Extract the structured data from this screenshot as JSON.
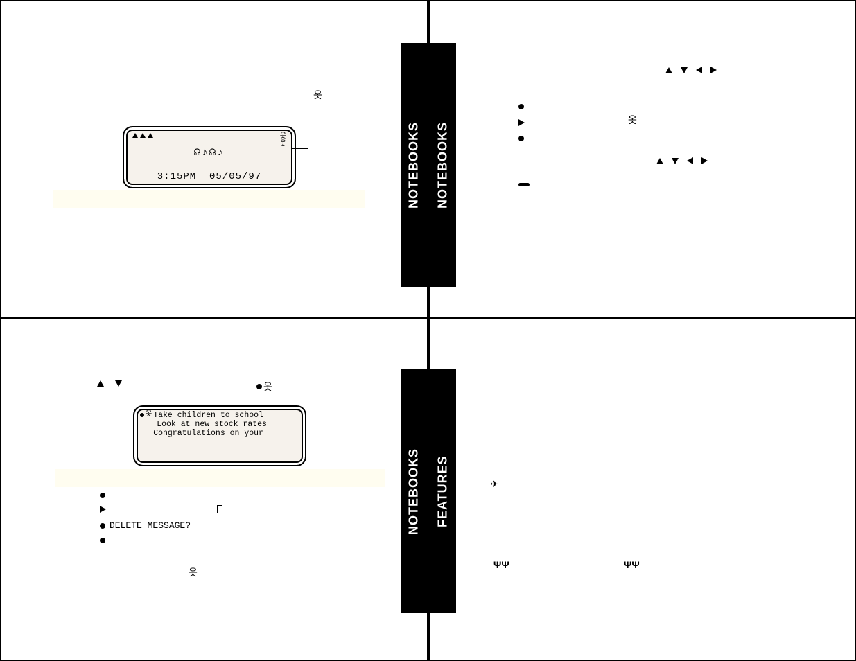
{
  "spines": {
    "p1_right": "NOTEBOOKS",
    "p2_left": "NOTEBOOKS",
    "p3_right": "NOTEBOOKS",
    "p4_left": "FEATURES"
  },
  "panel1": {
    "lcd": {
      "row2_symbols": "☊♪☊♪",
      "time": "3:15PM",
      "date": "05/05/97"
    }
  },
  "panel3": {
    "lcd": {
      "msg_lines": [
        "Take children to school",
        "Look at new stock rates",
        "Congratulations on your"
      ]
    },
    "delete_prompt": "DELETE MESSAGE?"
  }
}
